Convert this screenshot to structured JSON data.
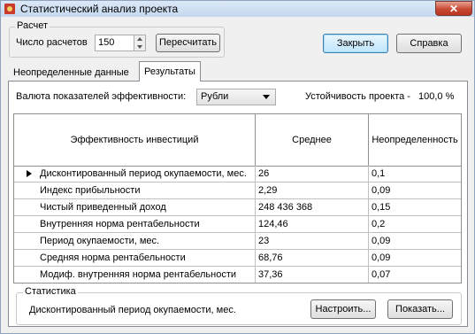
{
  "window": {
    "title": "Статистический анализ проекта",
    "close_glyph": "✕"
  },
  "calc": {
    "group_label": "Расчет",
    "count_label": "Число расчетов",
    "count_value": "150",
    "recalc_button": "Пересчитать"
  },
  "buttons": {
    "close": "Закрыть",
    "help": "Справка"
  },
  "tabs": [
    {
      "label": "Неопределенные данные"
    },
    {
      "label": "Результаты"
    }
  ],
  "results": {
    "currency_label": "Валюта показателей эффективности:",
    "currency_value": "Рубли",
    "stability_label": "Устойчивость проекта -",
    "stability_value": "100,0 %"
  },
  "table": {
    "headers": [
      "Эффективность инвестиций",
      "Среднее",
      "Неопределенность"
    ],
    "rows": [
      {
        "name": "Дисконтированный период окупаемости, мес.",
        "mean": "26",
        "uncertainty": "0,1"
      },
      {
        "name": "Индекс прибыльности",
        "mean": "2,29",
        "uncertainty": "0,09"
      },
      {
        "name": "Чистый приведенный доход",
        "mean": "248 436 368",
        "uncertainty": "0,15"
      },
      {
        "name": "Внутренняя норма рентабельности",
        "mean": "124,46",
        "uncertainty": "0,2"
      },
      {
        "name": "Период окупаемости, мес.",
        "mean": "23",
        "uncertainty": "0,09"
      },
      {
        "name": "Средняя норма рентабельности",
        "mean": "68,76",
        "uncertainty": "0,09"
      },
      {
        "name": "Модиф. внутренняя норма рентабельности",
        "mean": "37,36",
        "uncertainty": "0,07"
      }
    ]
  },
  "stats": {
    "group_label": "Статистика",
    "selected_text": "Дисконтированный период окупаемости, мес.",
    "setup_button": "Настроить...",
    "show_button": "Показать..."
  }
}
